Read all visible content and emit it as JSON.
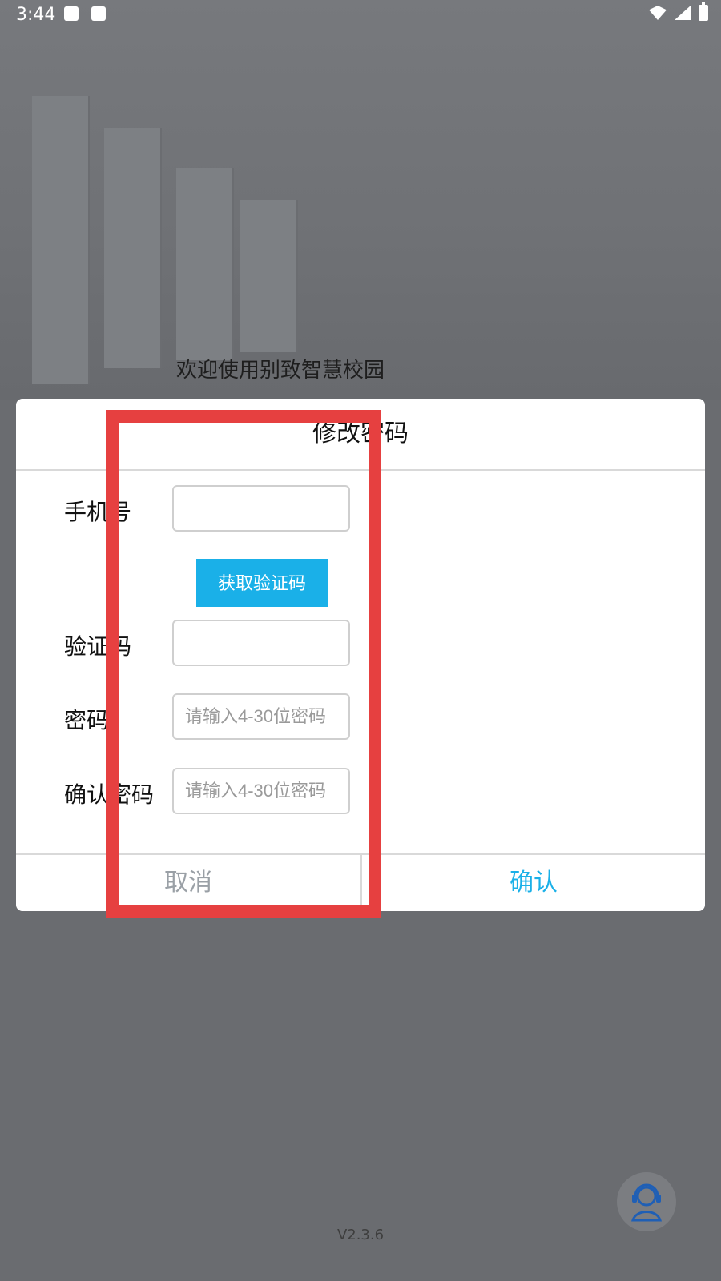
{
  "status_bar": {
    "time": "3:44",
    "icons": [
      "image-icon",
      "a-badge-icon"
    ],
    "right_icons": [
      "wifi-icon",
      "signal-icon",
      "battery-icon"
    ]
  },
  "welcome_text": "欢迎使用别致智慧校园",
  "dialog": {
    "title": "修改密码",
    "fields": [
      {
        "label": "手机号",
        "value": "",
        "placeholder": ""
      },
      {
        "label": "验证码",
        "value": "",
        "placeholder": ""
      },
      {
        "label": "密码",
        "value": "",
        "placeholder": "请输入4-30位密码"
      },
      {
        "label": "确认密码",
        "value": "",
        "placeholder": "请输入4-30位密码"
      }
    ],
    "get_code_label": "获取验证码",
    "cancel_label": "取消",
    "confirm_label": "确认"
  },
  "version": "V2.3.6",
  "colors": {
    "accent": "#1AB0E8",
    "highlight": "#E64040",
    "overlay": "#6A6C70"
  }
}
